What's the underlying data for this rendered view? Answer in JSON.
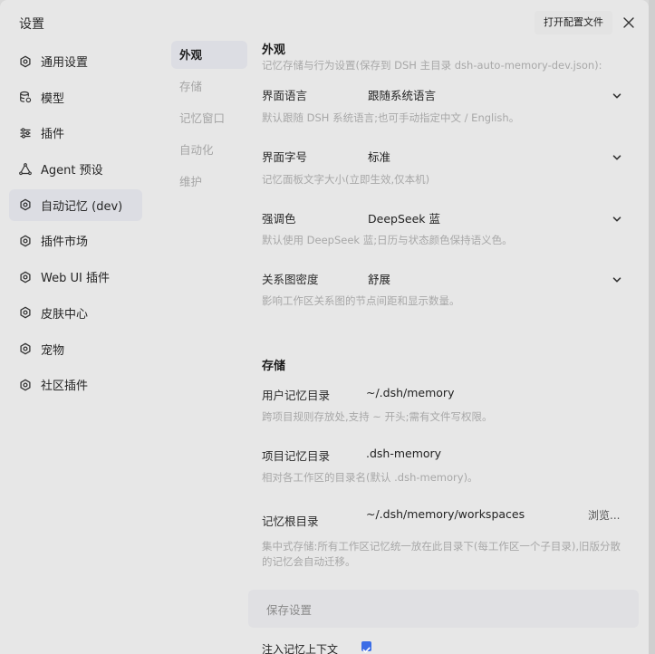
{
  "dialog": {
    "title": "设置",
    "open_config_label": "打开配置文件"
  },
  "nav": {
    "items": [
      {
        "label": "通用设置",
        "icon": "gear-icon",
        "active": false
      },
      {
        "label": "模型",
        "icon": "database-icon",
        "active": false
      },
      {
        "label": "插件",
        "icon": "sliders-icon",
        "active": false
      },
      {
        "label": "Agent 预设",
        "icon": "agent-icon",
        "active": false
      },
      {
        "label": "自动记忆 (dev)",
        "icon": "gear-icon",
        "active": true
      },
      {
        "label": "插件市场",
        "icon": "gear-icon",
        "active": false
      },
      {
        "label": "Web UI 插件",
        "icon": "gear-icon",
        "active": false
      },
      {
        "label": "皮肤中心",
        "icon": "gear-icon",
        "active": false
      },
      {
        "label": "宠物",
        "icon": "gear-icon",
        "active": false
      },
      {
        "label": "社区插件",
        "icon": "gear-icon",
        "active": false
      }
    ]
  },
  "subnav": {
    "items": [
      {
        "label": "外观",
        "active": true
      },
      {
        "label": "存储",
        "active": false
      },
      {
        "label": "记忆窗口",
        "active": false
      },
      {
        "label": "自动化",
        "active": false
      },
      {
        "label": "维护",
        "active": false
      }
    ]
  },
  "appearance": {
    "title": "外观",
    "desc": "记忆存储与行为设置(保存到 DSH 主目录 dsh-auto-memory-dev.json):",
    "rows": [
      {
        "label": "界面语言",
        "value": "跟随系统语言",
        "desc": "默认跟随 DSH 系统语言;也可手动指定中文 / English。"
      },
      {
        "label": "界面字号",
        "value": "标准",
        "desc": "记忆面板文字大小(立即生效,仅本机)"
      },
      {
        "label": "强调色",
        "value": "DeepSeek 蓝",
        "desc": "默认使用 DeepSeek 蓝;日历与状态颜色保持语义色。"
      },
      {
        "label": "关系图密度",
        "value": "舒展",
        "desc": "影响工作区关系图的节点间距和显示数量。"
      }
    ]
  },
  "storage": {
    "title": "存储",
    "rows": [
      {
        "label": "用户记忆目录",
        "value": "~/.dsh/memory",
        "desc": "跨项目规则存放处,支持 ~ 开头;需有文件写权限。"
      },
      {
        "label": "项目记忆目录",
        "value": ".dsh-memory",
        "desc": "相对各工作区的目录名(默认 .dsh-memory)。"
      },
      {
        "label": "记忆根目录",
        "value": "~/.dsh/memory/workspaces",
        "desc": "集中式存储:所有工作区记忆统一放在此目录下(每工作区一个子目录),旧版分散的记忆会自动迁移。",
        "action": "浏览..."
      }
    ]
  },
  "save": {
    "label": "保存设置"
  },
  "partial": {
    "label": "注入记忆上下文",
    "checked": true
  }
}
